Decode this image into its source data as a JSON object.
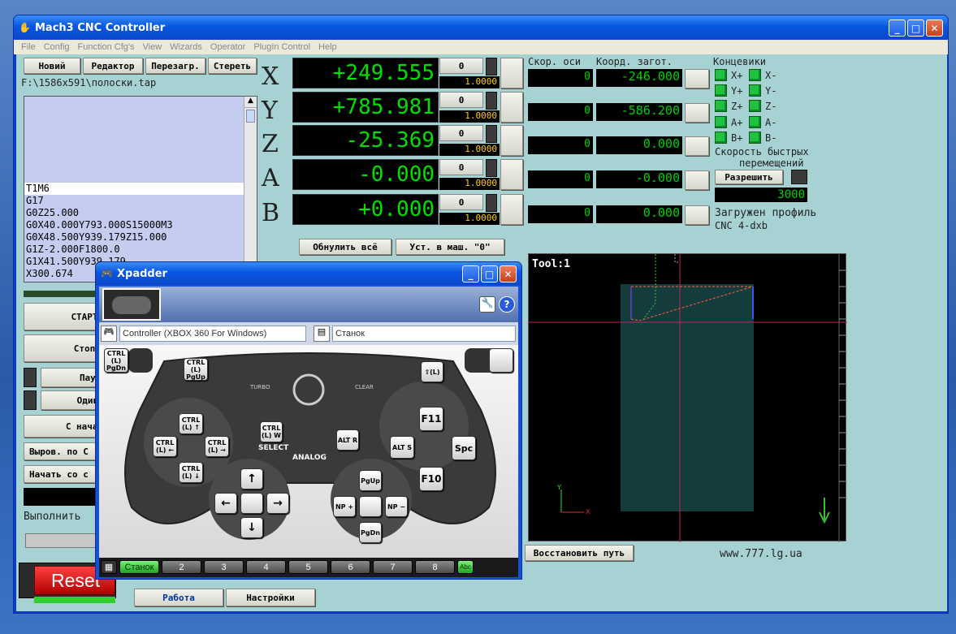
{
  "window": {
    "title": "Mach3 CNC Controller"
  },
  "menu": [
    "File",
    "Config",
    "Function Cfg's",
    "View",
    "Wizards",
    "Operator",
    "PlugIn Control",
    "Help"
  ],
  "file_buttons": [
    "Новий",
    "Редактор",
    "Перезагр.",
    "Стереть"
  ],
  "file_path": "F:\\1586x591\\полоски.tap",
  "gcode": [
    "T1M6",
    "G17",
    "G0Z25.000",
    "G0X40.000Y793.000S15000M3",
    "G0X48.500Y939.179Z15.000",
    "G1Z-2.000F1800.0",
    "G1X41.500Y939.179",
    "X300.674"
  ],
  "left_buttons": [
    "СТАРТ",
    "Стоп",
    "Пауза",
    "Один ш",
    "С начал",
    "Выров. по С",
    "Начать со с"
  ],
  "left_texts": {
    "exec": "Выполнить",
    "reset": "Reset"
  },
  "axes": [
    {
      "name": "X",
      "value": "+249.555",
      "zero": "0",
      "scale": "1.0000",
      "speed": "0",
      "coord": "-246.000"
    },
    {
      "name": "Y",
      "value": "+785.981",
      "zero": "0",
      "scale": "1.0000",
      "speed": "0",
      "coord": "-586.200"
    },
    {
      "name": "Z",
      "value": "-25.369",
      "zero": "0",
      "scale": "1.0000",
      "speed": "0",
      "coord": "0.000"
    },
    {
      "name": "A",
      "value": "-0.000",
      "zero": "0",
      "scale": "1.0000",
      "speed": "0",
      "coord": "-0.000"
    },
    {
      "name": "B",
      "value": "+0.000",
      "zero": "0",
      "scale": "1.0000",
      "speed": "0",
      "coord": "0.000"
    }
  ],
  "headers": {
    "speed": "Скор. оси",
    "coord": "Коорд. загот.",
    "limits": "Концевики"
  },
  "limits": [
    "X+",
    "X-",
    "Y+",
    "Y-",
    "Z+",
    "Z-",
    "A+",
    "A-",
    "B+",
    "B-"
  ],
  "rapid": {
    "label1": "Скорость быстрых",
    "label2": "перемещений",
    "button": "Разрешить",
    "value": "3000"
  },
  "profile": {
    "line1": "Загружен профиль",
    "line2": "CNC 4-dxb"
  },
  "mid_buttons": {
    "zero_all": "Обнулить всё",
    "set_machine": "Уст. в маш. \"0\""
  },
  "toolpath": {
    "label": "Tool:1",
    "restore": "Восстановить путь",
    "url": "www.777.lg.ua"
  },
  "bottom_tabs": [
    "Работа",
    "Настройки"
  ],
  "xpadder": {
    "title": "Xpadder",
    "controller": "Controller (XBOX 360 For Windows)",
    "profile": "Станок",
    "labels": {
      "turbo": "TURBO",
      "clear": "CLEAR",
      "select": "SELECT",
      "analog": "ANALOG"
    },
    "keys": {
      "lt": "CTRL (L) PgDn",
      "lb": "CTRL (L) PgUp",
      "rb": "⇧(L)",
      "ls_up": "CTRL (L) ↑",
      "ls_left": "CTRL (L) ←",
      "ls_right": "CTRL (L) →",
      "ls_down": "CTRL (L) ↓",
      "back": "CTRL (L) W",
      "start": "ALT R",
      "y": "F11",
      "x": "ALT S",
      "b": "Spc",
      "a": "F10",
      "rs_up": "PgUp",
      "rs_left": "NP +",
      "rs_right": "NP −",
      "rs_down": "PgDn"
    },
    "tabs": [
      "Станок",
      "2",
      "3",
      "4",
      "5",
      "6",
      "7",
      "8"
    ],
    "abc": "Abc"
  }
}
